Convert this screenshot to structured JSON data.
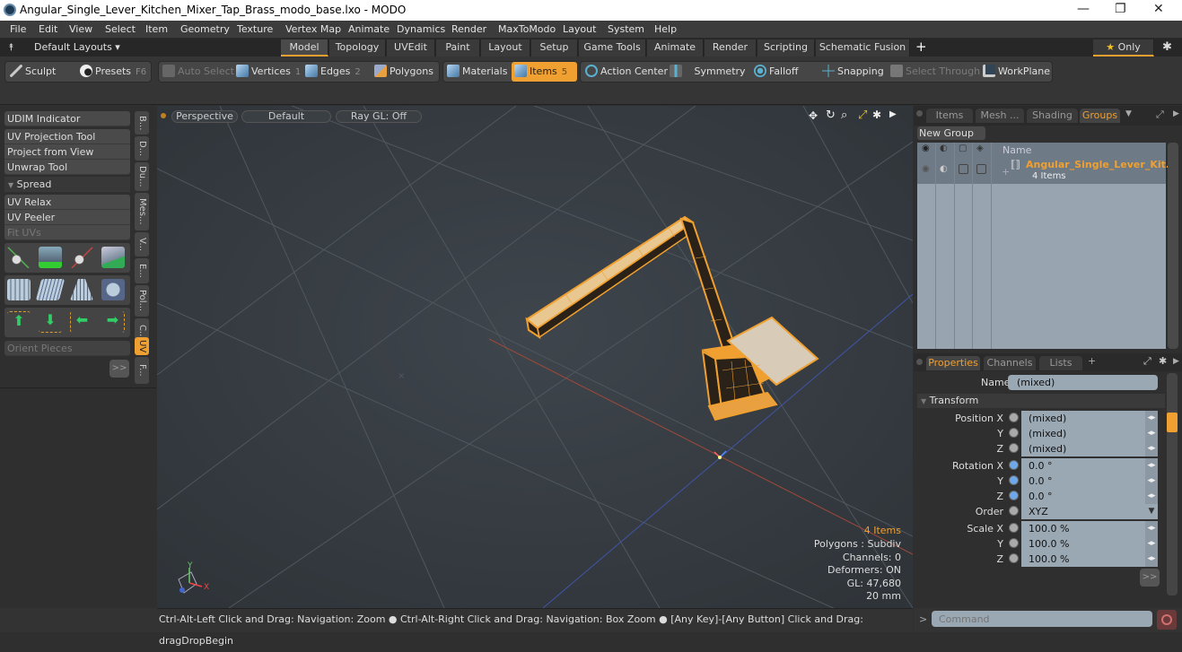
{
  "window": {
    "title": "Angular_Single_Lever_Kitchen_Mixer_Tap_Brass_modo_base.lxo - MODO",
    "controls": {
      "minimize": "—",
      "restore": "❐",
      "close": "✕"
    }
  },
  "menubar": [
    "File",
    "Edit",
    "View",
    "Select",
    "Item",
    "Geometry",
    "Texture",
    "Vertex Map",
    "Animate",
    "Dynamics",
    "Render",
    "MaxToModo",
    "Layout",
    "System",
    "Help"
  ],
  "layouts": {
    "preset_label": "Default Layouts ▾",
    "tabs": [
      "Model",
      "Topology",
      "UVEdit",
      "Paint",
      "Layout",
      "Setup",
      "Game Tools",
      "Animate",
      "Render",
      "Scripting",
      "Schematic Fusion"
    ],
    "active_tab": "Model",
    "add_label": "+",
    "only_label": "★ Only"
  },
  "toolbar": {
    "sculpt": "Sculpt",
    "presets": "Presets",
    "presets_key": "F6",
    "auto_select": "Auto Select",
    "vertices": "Vertices",
    "vertices_key": "1",
    "edges": "Edges",
    "edges_key": "2",
    "polygons": "Polygons",
    "materials": "Materials",
    "items": "Items",
    "items_key": "5",
    "action_center": "Action Center",
    "symmetry": "Symmetry",
    "falloff": "Falloff",
    "snapping": "Snapping",
    "select_through": "Select Through",
    "workplane": "WorkPlane"
  },
  "left_panel": {
    "udim": "UDIM Indicator",
    "tools": [
      "UV Projection Tool",
      "Project from View",
      "Unwrap Tool"
    ],
    "spread": "Spread",
    "tools2": [
      "UV Relax",
      "UV Peeler"
    ],
    "fit_uvs": "Fit UVs",
    "orient_pieces": "Orient Pieces",
    "more": ">>",
    "vtabs": [
      "B...",
      "D...",
      "Du...",
      "Mes...",
      "V...",
      "E...",
      "Pol...",
      "C...",
      "UV",
      "F..."
    ],
    "active_vtab": "UV"
  },
  "viewport": {
    "view": "Perspective",
    "style": "Default",
    "raygl": "Ray GL: Off",
    "stats": {
      "items": "4 Items",
      "polygons": "Polygons : Subdiv",
      "channels": "Channels: 0",
      "deformers": "Deformers: ON",
      "gl": "GL: 47,680",
      "unit": "20 mm"
    },
    "axis": {
      "y": "Y",
      "x": "X"
    }
  },
  "groups_panel": {
    "tabs": [
      "Items",
      "Mesh ...",
      "Shading",
      "Groups"
    ],
    "active_tab": "Groups",
    "new_group": "New Group",
    "col_name": "Name",
    "group_name": "Angular_Single_Lever_Kit...",
    "group_count": "4 Items"
  },
  "properties": {
    "tabs": [
      "Properties",
      "Channels",
      "Lists"
    ],
    "active_tab": "Properties",
    "add": "+",
    "name_label": "Name",
    "name_value": "(mixed)",
    "section": "Transform",
    "rows": [
      {
        "label": "Position X",
        "value": "(mixed)",
        "dot": "gray"
      },
      {
        "label": "Y",
        "value": "(mixed)",
        "dot": "gray"
      },
      {
        "label": "Z",
        "value": "(mixed)",
        "dot": "gray"
      },
      {
        "label": "Rotation X",
        "value": "0.0 °",
        "dot": "blue"
      },
      {
        "label": "Y",
        "value": "0.0 °",
        "dot": "blue"
      },
      {
        "label": "Z",
        "value": "0.0 °",
        "dot": "blue"
      },
      {
        "label": "Order",
        "value": "XYZ",
        "dot": "gray"
      },
      {
        "label": "Scale X",
        "value": "100.0 %",
        "dot": "gray"
      },
      {
        "label": "Y",
        "value": "100.0 %",
        "dot": "gray"
      },
      {
        "label": "Z",
        "value": "100.0 %",
        "dot": "gray"
      }
    ],
    "more": ">>"
  },
  "statusbar": "Ctrl-Alt-Left Click and Drag: Navigation: Zoom ● Ctrl-Alt-Right Click and Drag: Navigation: Box Zoom ● [Any Key]-[Any Button] Click and Drag: dragDropBegin",
  "command": {
    "prompt": ">",
    "placeholder": "Command"
  },
  "colors": {
    "accent": "#f0a030",
    "selection": "#f0a030"
  }
}
